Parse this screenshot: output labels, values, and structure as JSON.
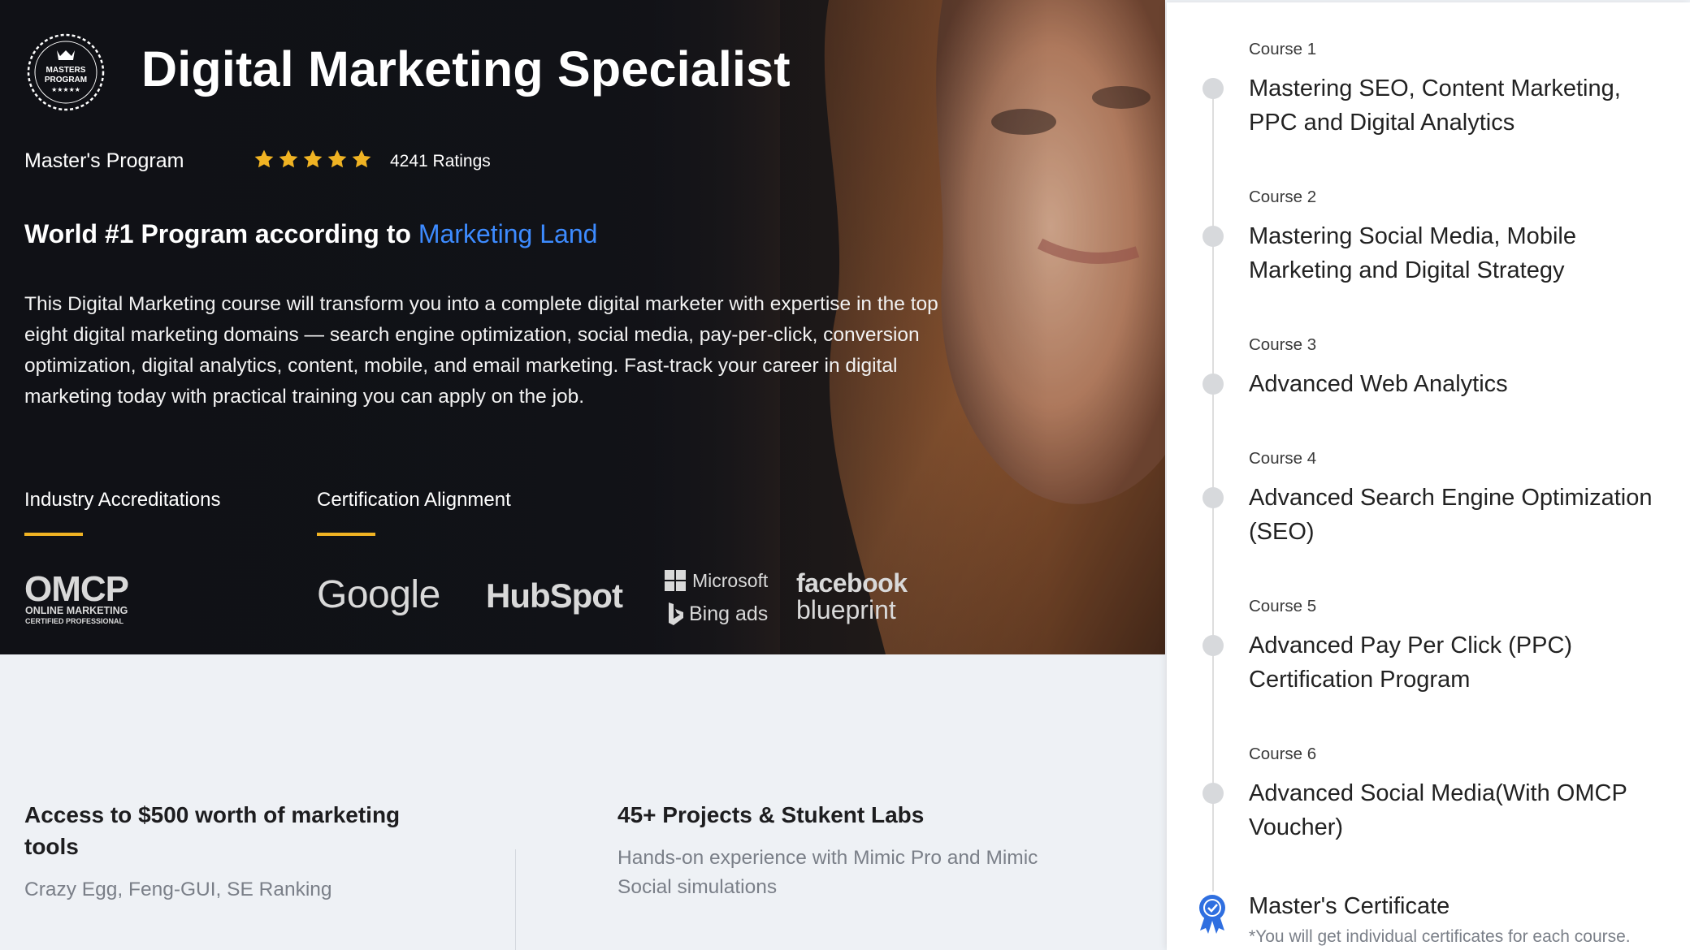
{
  "hero": {
    "badge": {
      "line1": "MASTERS",
      "line2": "PROGRAM",
      "stars": "★★★★★"
    },
    "title": "Digital Marketing Specialist",
    "program_type": "Master's Program",
    "rating_stars": 5,
    "ratings_text": "4241 Ratings",
    "ranking_prefix": "World #1 Program according to ",
    "ranking_link": "Marketing Land",
    "description": "This Digital Marketing course will transform you into a complete digital marketer with expertise in the top eight digital marketing domains — search engine optimization, social media, pay-per-click, conversion optimization, digital analytics, content, mobile, and email marketing. Fast-track your career in digital marketing today with practical training you can apply on the job.",
    "accreditations_title": "Industry Accreditations",
    "alignment_title": "Certification Alignment",
    "omcp": {
      "name": "OMCP",
      "line1": "ONLINE MARKETING",
      "line2": "CERTIFIED PROFESSIONAL"
    },
    "alignment_logos": {
      "google": "Google",
      "hubspot": "HubSpot",
      "microsoft": "Microsoft",
      "bing": "Bing ads",
      "facebook": "facebook",
      "blueprint": "blueprint"
    },
    "accent_color": "#f0b323",
    "link_color": "#3d8bff"
  },
  "features": [
    {
      "title": "Access to $500 worth of marketing tools",
      "desc": "Crazy Egg, Feng-GUI, SE Ranking"
    },
    {
      "title": "45+ Projects & Stukent Labs",
      "desc": "Hands-on experience with Mimic Pro and Mimic Social simulations"
    }
  ],
  "courses": [
    {
      "label": "Course 1",
      "name": "Mastering SEO, Content Marketing, PPC and Digital Analytics"
    },
    {
      "label": "Course 2",
      "name": "Mastering Social Media, Mobile Marketing and Digital Strategy"
    },
    {
      "label": "Course 3",
      "name": "Advanced Web Analytics"
    },
    {
      "label": "Course 4",
      "name": "Advanced Search Engine Optimization (SEO)"
    },
    {
      "label": "Course 5",
      "name": "Advanced Pay Per Click (PPC) Certification Program"
    },
    {
      "label": "Course 6",
      "name": "Advanced Social Media(With OMCP Voucher)"
    }
  ],
  "certificate": {
    "title": "Master's Certificate",
    "note": "*You will get individual certificates for each course."
  }
}
